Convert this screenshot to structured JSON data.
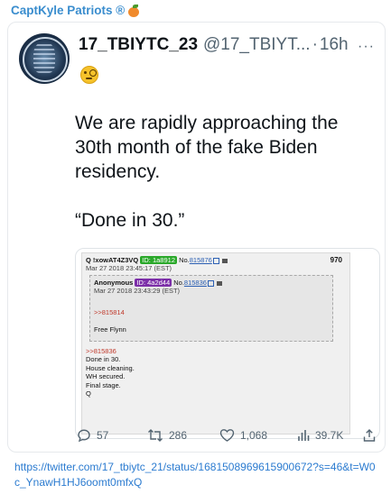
{
  "channel": {
    "name": "CaptKyle Patriots ®",
    "emoji": "peach"
  },
  "tweet": {
    "display_name": "17_TBIYTC_23",
    "handle": "@17_TBIYT...",
    "separator": "·",
    "time": "16h",
    "more": "···",
    "emoji": "face-with-monocle",
    "text_1": "We are rapidly approaching the 30th month of the fake Biden residency.",
    "text_2": "“Done in 30.”"
  },
  "embedded_post": {
    "outer_author": "Q !xowAT4Z3VQ",
    "outer_id": "ID: 1a8912",
    "outer_no_label": "No.",
    "outer_no": "815876",
    "outer_right_no": "970",
    "outer_date": "Mar 27 2018 23:45:17 (EST)",
    "inner_author": "Anonymous",
    "inner_id": "ID: 4a2d44",
    "inner_no_label": "No.",
    "inner_no": "815836",
    "inner_date": "Mar 27 2018 23:43:29 (EST)",
    "inner_reply": ">>815814",
    "inner_message": "Free Flynn",
    "outer_reply": ">>815836",
    "outer_lines": [
      "Done in 30.",
      "House cleaning.",
      "WH secured.",
      "Final stage.",
      "Q"
    ]
  },
  "actions": {
    "replies": "57",
    "retweets": "286",
    "likes": "1,068",
    "views": "39.7K"
  },
  "link": "https://twitter.com/17_tbiytc_21/status/1681508969615900672?s=46&t=W0c_YnawH1HJ6oomt0mfxQ",
  "colors": {
    "channel": "#3a8dce",
    "link": "#2b7bd0",
    "muted": "#536471"
  }
}
